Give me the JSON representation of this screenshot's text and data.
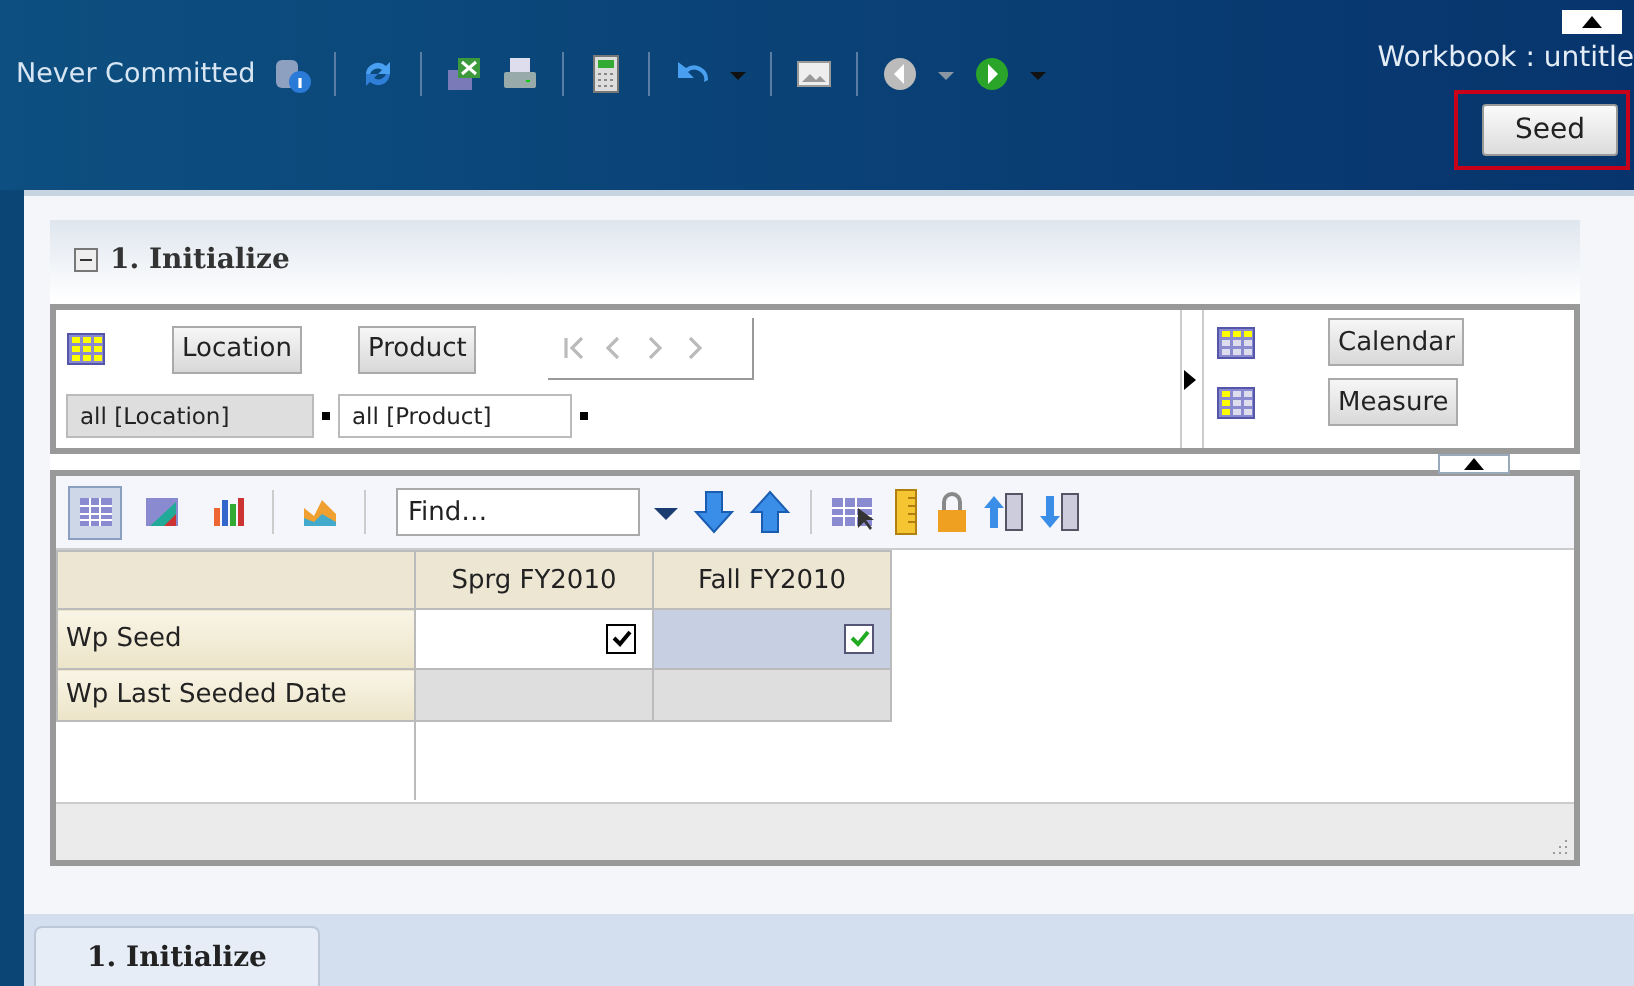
{
  "header": {
    "status": "Never Committed",
    "workbook": "Workbook : untitle",
    "seed_button": "Seed"
  },
  "panel": {
    "title": "1. Initialize",
    "expanded": true
  },
  "pivot": {
    "row_dims": [
      "Location",
      "Product"
    ],
    "row_values": [
      {
        "label": "all [Location]",
        "selected": true
      },
      {
        "label": "all [Product]",
        "selected": false
      }
    ],
    "col_dims": [
      "Calendar",
      "Measure"
    ]
  },
  "views": [
    {
      "kind": "table",
      "selected": true
    },
    {
      "kind": "chart-table",
      "selected": false
    },
    {
      "kind": "bar",
      "selected": false
    },
    {
      "kind": "area",
      "selected": false
    }
  ],
  "find": {
    "placeholder": "Find…"
  },
  "grid": {
    "columns": [
      "Sprg FY2010",
      "Fall FY2010"
    ],
    "rows": [
      {
        "label": "Wp Seed",
        "cells": [
          {
            "kind": "checkbox",
            "checked": true,
            "selected": false
          },
          {
            "kind": "checkbox",
            "checked": true,
            "selected": true
          }
        ]
      },
      {
        "label": "Wp Last Seeded Date",
        "cells": [
          {
            "kind": "empty",
            "selected": false
          },
          {
            "kind": "empty",
            "selected": false
          }
        ]
      }
    ]
  },
  "bottom_tabs": [
    {
      "label": "1. Initialize",
      "selected": true
    }
  ]
}
